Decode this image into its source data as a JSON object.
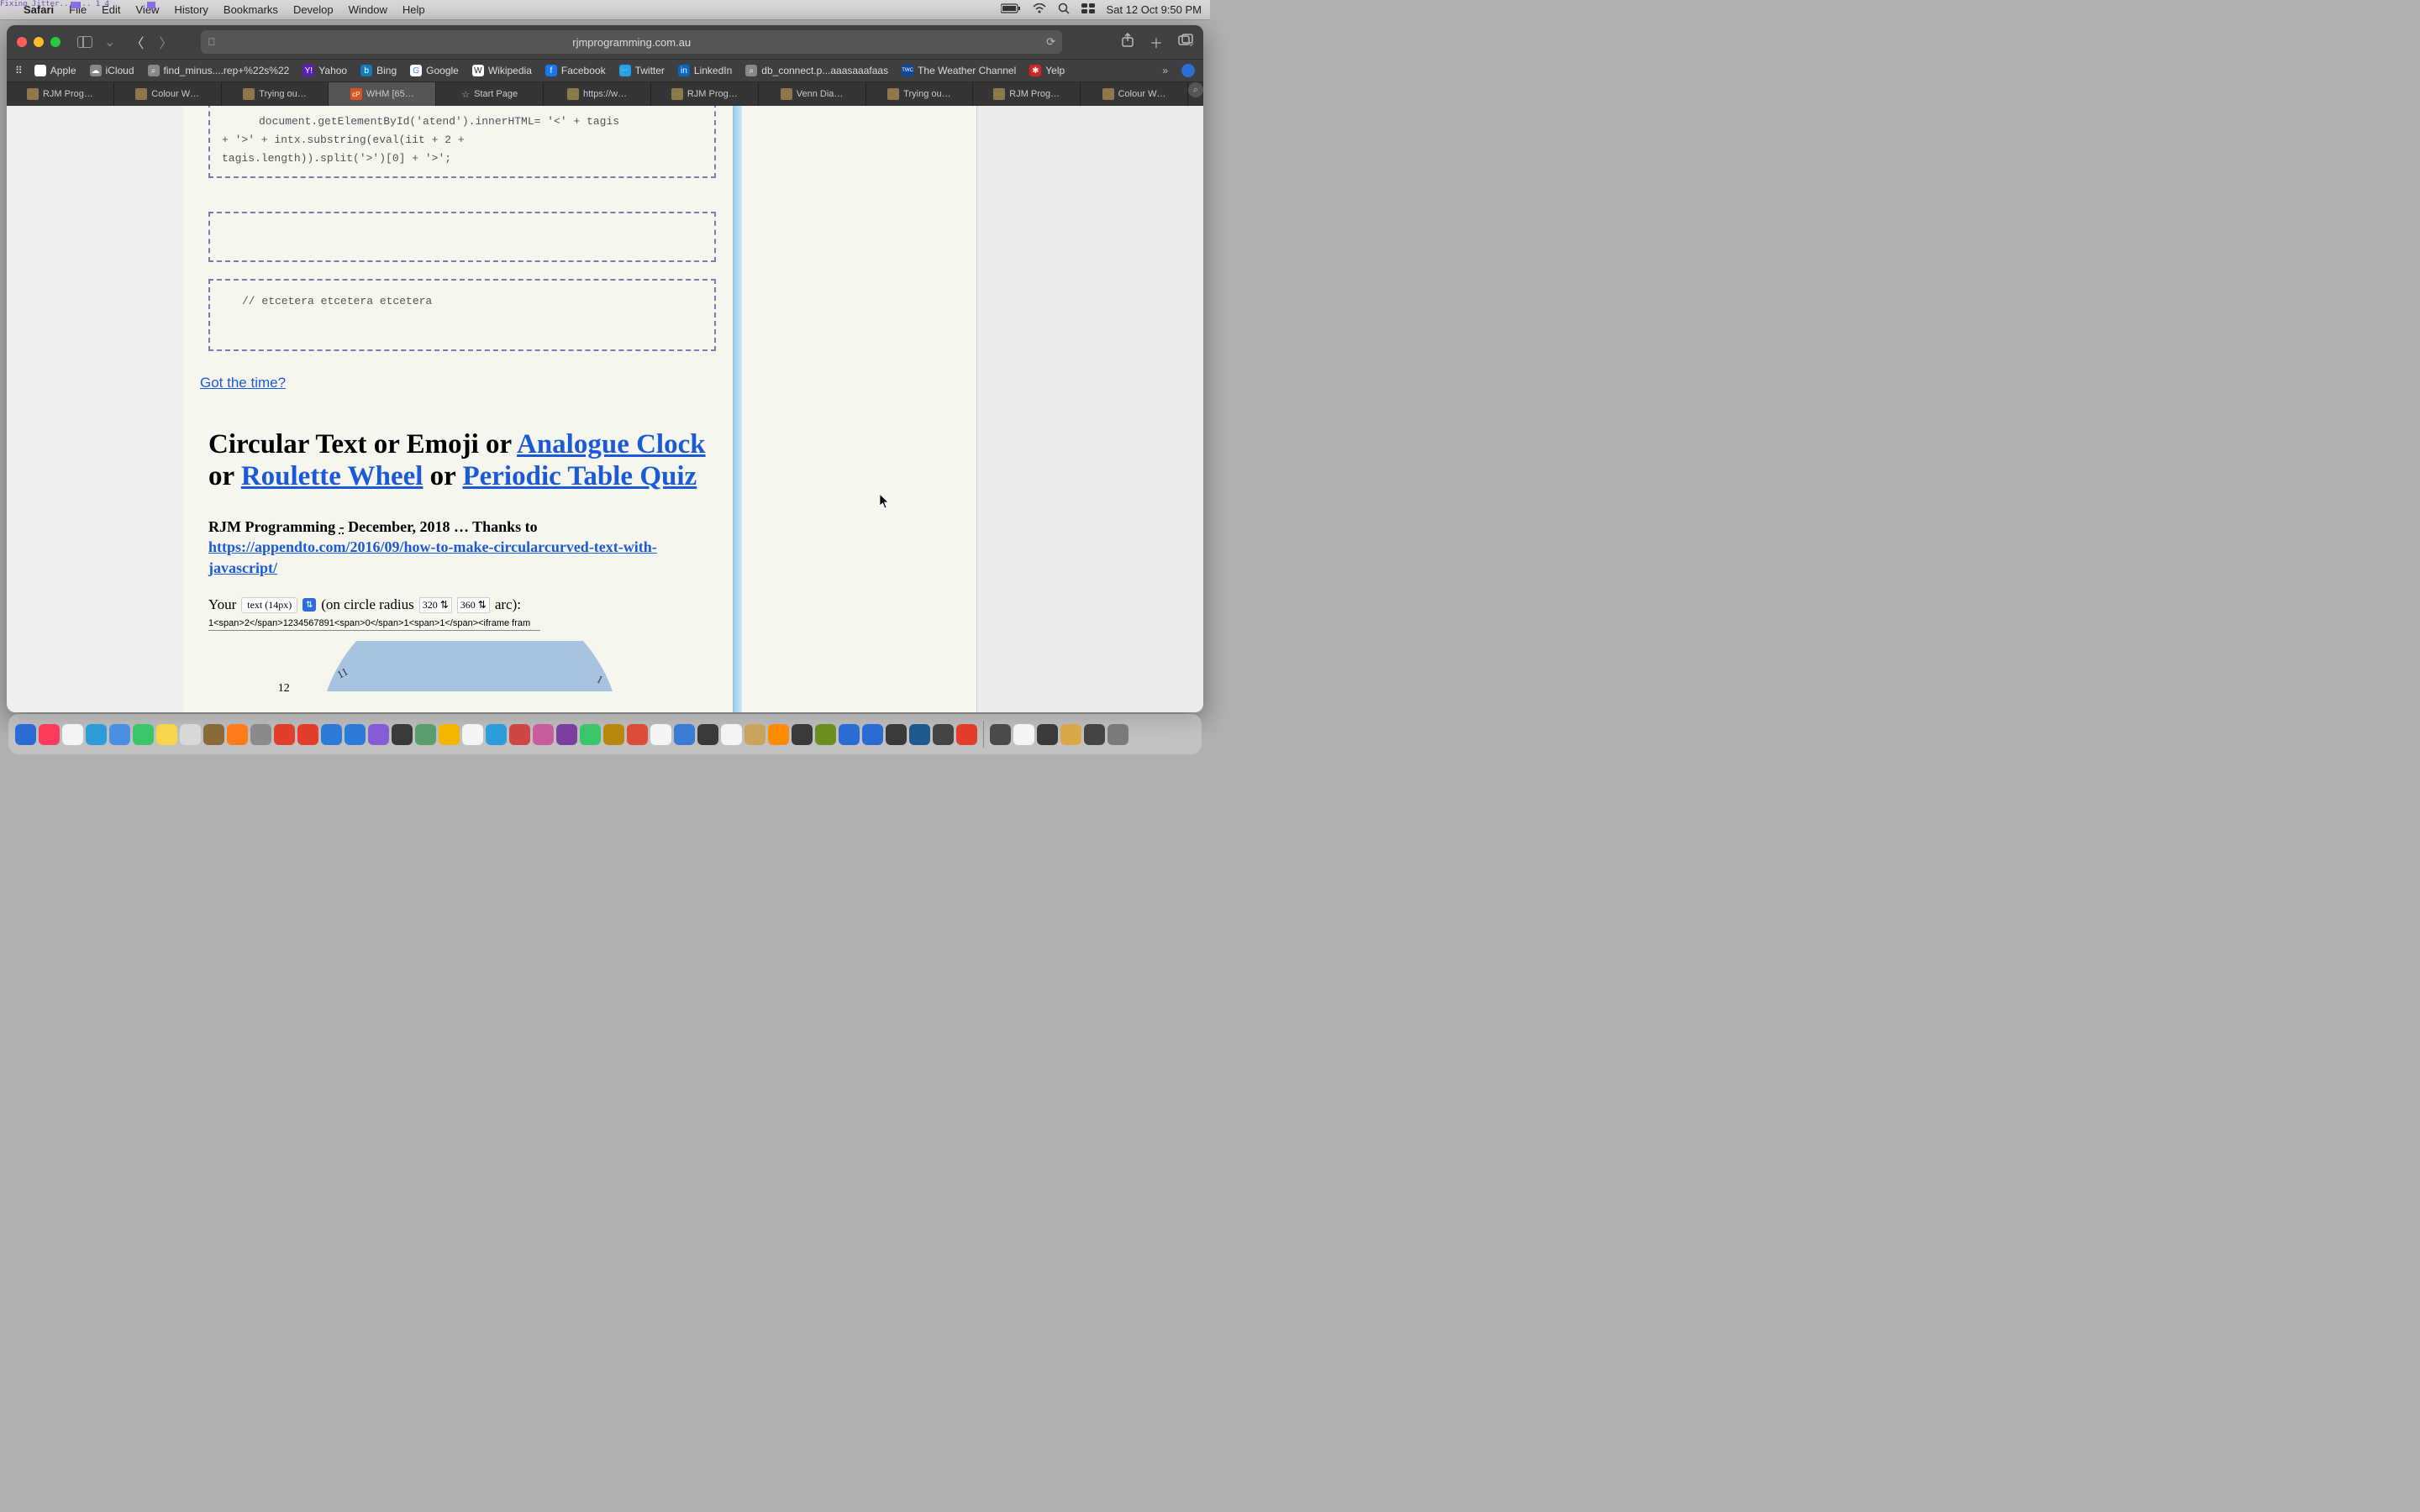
{
  "menubar": {
    "app": "Safari",
    "items": [
      "File",
      "Edit",
      "View",
      "History",
      "Bookmarks",
      "Develop",
      "Window",
      "Help"
    ],
    "clock": "Sat 12 Oct  9:50 PM"
  },
  "window": {
    "url": "rjmprogramming.com.au"
  },
  "favorites": [
    {
      "label": "Apple",
      "bg": "#fff",
      "glyph": ""
    },
    {
      "label": "iCloud",
      "bg": "#666",
      "glyph": "☁"
    },
    {
      "label": "find_minus....rep+%22s%22",
      "bg": "#666",
      "glyph": "⌕"
    },
    {
      "label": "Yahoo",
      "bg": "#5f1fb5",
      "glyph": "Y!"
    },
    {
      "label": "Bing",
      "bg": "#0a7",
      "glyph": "b"
    },
    {
      "label": "Google",
      "bg": "#fff",
      "glyph": "G"
    },
    {
      "label": "Wikipedia",
      "bg": "#fff",
      "glyph": "W"
    },
    {
      "label": "Facebook",
      "bg": "#1877f2",
      "glyph": "f"
    },
    {
      "label": "Twitter",
      "bg": "#1da1f2",
      "glyph": "t"
    },
    {
      "label": "LinkedIn",
      "bg": "#0a66c2",
      "glyph": "in"
    },
    {
      "label": "db_connect.p...aaasaaafaas",
      "bg": "#666",
      "glyph": "⌕"
    },
    {
      "label": "The Weather Channel",
      "bg": "#0a4b9c",
      "glyph": "TW"
    },
    {
      "label": "Yelp",
      "bg": "#d32323",
      "glyph": "y"
    }
  ],
  "tabs": [
    {
      "label": "RJM Prog…",
      "icon": "#8d7a4a"
    },
    {
      "label": "Colour W…",
      "icon": "#8d7a4a"
    },
    {
      "label": "Trying ou…",
      "icon": "#8d7a4a"
    },
    {
      "label": "WHM [65…",
      "icon": "#d9531e",
      "active": true
    },
    {
      "label": "Start Page",
      "icon": "star"
    },
    {
      "label": "https://w…",
      "icon": "#8d7a4a"
    },
    {
      "label": "RJM Prog…",
      "icon": "#8d7a4a"
    },
    {
      "label": "Venn Dia…",
      "icon": "#8d7a4a"
    },
    {
      "label": "Trying ou…",
      "icon": "#8d7a4a"
    },
    {
      "label": "RJM Prog…",
      "icon": "#8d7a4a"
    },
    {
      "label": "Colour W…",
      "icon": "#8d7a4a"
    }
  ],
  "content": {
    "code1": "document.getElementById('atend').innerHTML= '<' + tagis",
    "code2": "+ '>' + intx.substring(eval(iit + 2 +",
    "code3": "tagis.length)).split('>')[0] + '>';",
    "etc": "// etcetera etcetera etcetera",
    "gottime": "Got the time?",
    "h1_a": "Circular Text or Emoji or ",
    "h1_link1": "Analogue Clock",
    "h1_b": " or ",
    "h1_link2": "Roulette Wheel",
    "h1_c": " or ",
    "h1_link3": "Periodic Table Quiz",
    "sub_a": "RJM Programming ",
    "sub_dash": "-",
    "sub_b": " December, 2018 … Thanks to ",
    "sub_link": "https://appendto.com/2016/09/how-to-make-circularcurved-text-with-javascript/",
    "your": "Your",
    "textsel": "text (14px)",
    "on_radius": "(on circle radius",
    "num1": "320",
    "num2": "360",
    "arc": "arc):",
    "span_input": "1<span>2</span>1234567891<span>0</span>1<span>1</span><iframe fram",
    "clock12": "12",
    "clock11": "11",
    "clock1": "1"
  },
  "overlay": "Fixing Jitter... ...  1    4",
  "dock_colors": [
    "#2b6cd4",
    "#fb3b5c",
    "#f4f4f4",
    "#2d9cdb",
    "#4a90e2",
    "#3ac569",
    "#f5d54a",
    "#d8d8d8",
    "#8b6a3a",
    "#ff7b1a",
    "#8a8a8a",
    "#e33e2b",
    "#e33e2b",
    "#2d7bd9",
    "#2d7bd9",
    "#855cd6",
    "#3a3a3a",
    "#5a9e6f",
    "#f4b400",
    "#f4f4f4",
    "#2d9cdb",
    "#cf4647",
    "#c85c9e",
    "#7b3fa0",
    "#3ac569",
    "#b8860b",
    "#dd4b39",
    "#f4f4f4",
    "#3a7bd5",
    "#3a3a3a",
    "#f4f4f4",
    "#c8a45c",
    "#ff8c00",
    "#3a3a3a",
    "#6b8e23",
    "#2b6cd4",
    "#2b6cd4",
    "#3a3a3a",
    "#1e5a8e",
    "#444",
    "#e33e2b",
    "#4a4a4a",
    "#f4f4f4",
    "#3a3a3a",
    "#d8a847",
    "#444",
    "#7a7a7a"
  ]
}
